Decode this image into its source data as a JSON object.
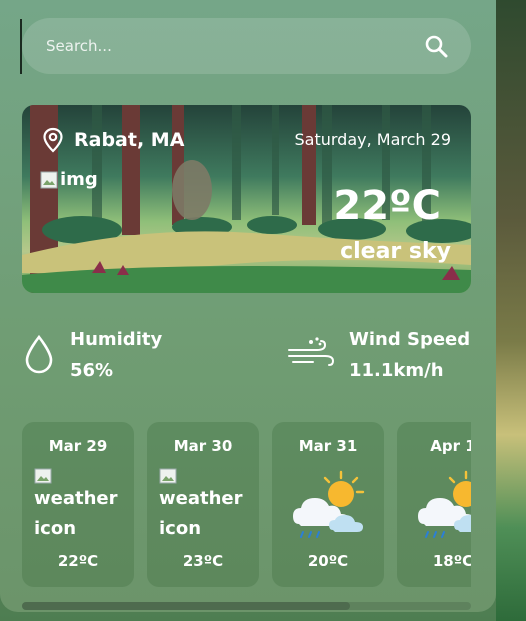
{
  "search": {
    "placeholder": "Search..."
  },
  "current": {
    "location": "Rabat, MA",
    "date": "Saturday, March 29",
    "image_alt": "img",
    "temperature": "22ºC",
    "description": "clear sky"
  },
  "stats": {
    "humidity": {
      "label": "Humidity",
      "value": "56%"
    },
    "wind": {
      "label": "Wind Speed",
      "value": "11.1km/h"
    }
  },
  "forecast": [
    {
      "date": "Mar 29",
      "icon": "broken-image",
      "icon_alt_1": "weather",
      "icon_alt_2": "icon",
      "temp": "22ºC"
    },
    {
      "date": "Mar 30",
      "icon": "broken-image",
      "icon_alt_1": "weather",
      "icon_alt_2": "icon",
      "temp": "23ºC"
    },
    {
      "date": "Mar 31",
      "icon": "sun-cloud-rain-icon",
      "temp": "20ºC"
    },
    {
      "date": "Apr 1",
      "icon": "sun-cloud-rain-icon",
      "temp": "18ºC"
    }
  ],
  "scrollbar": {
    "position": 0.73
  }
}
